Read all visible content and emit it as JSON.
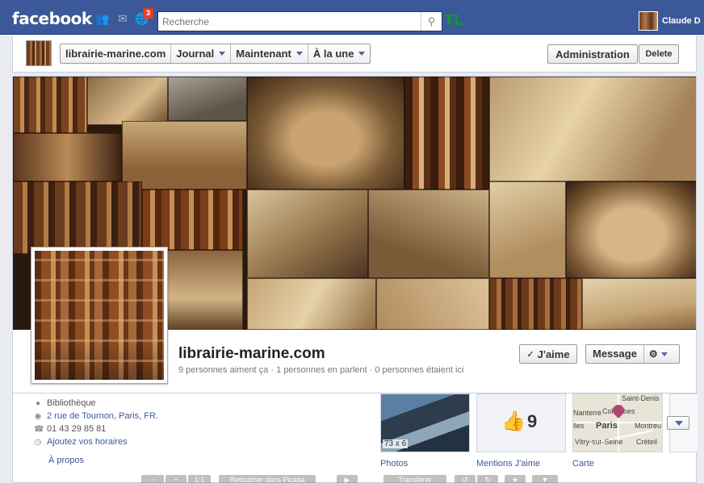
{
  "topbar": {
    "logo": "facebook",
    "notification_count": "3",
    "search_placeholder": "Recherche",
    "tl_badge": "TL",
    "user_name": "Claude D"
  },
  "pagebar": {
    "nav": [
      {
        "label": "librairie-marine.com",
        "has_caret": false
      },
      {
        "label": "Journal",
        "has_caret": true
      },
      {
        "label": "Maintenant",
        "has_caret": true
      },
      {
        "label": "À la une",
        "has_caret": true
      }
    ],
    "admin_label": "Administration",
    "delete_label": "Delete"
  },
  "profile": {
    "name": "librairie-marine.com",
    "stats": "9 personnes aiment ça · 1 personnes en parlent · 0 personnes étaient ici",
    "like_label": "J'aime",
    "message_label": "Message",
    "gear_label": "⚙"
  },
  "info": {
    "category": "Bibliothèque",
    "address_street": "2 rue de Tournon",
    "address_city": "Paris",
    "address_country": "FR.",
    "phone": "01 43 29 85 81",
    "hours_link": "Ajoutez vos horaires",
    "about_link": "À propos"
  },
  "apps": {
    "photos_label": "Photos",
    "photos_overlay": "73 x 6",
    "likes_label": "Mentions J'aime",
    "likes_count": "9",
    "map_label": "Carte",
    "map_places": [
      "Saint-Denis",
      "Colombes",
      "lles",
      "Paris",
      "Montreu",
      "Nanterre",
      "Vitry-sur-Seine",
      "Créteil"
    ]
  },
  "ghost_toolbar": {
    "zoom": "1:1",
    "left_text": "Retoucher dans Picasa",
    "right_text": "Transférer"
  },
  "colors": {
    "brand": "#3b5998",
    "link": "#3b5998",
    "badge": "#f03d25",
    "tl_green": "#0e9b2e"
  }
}
